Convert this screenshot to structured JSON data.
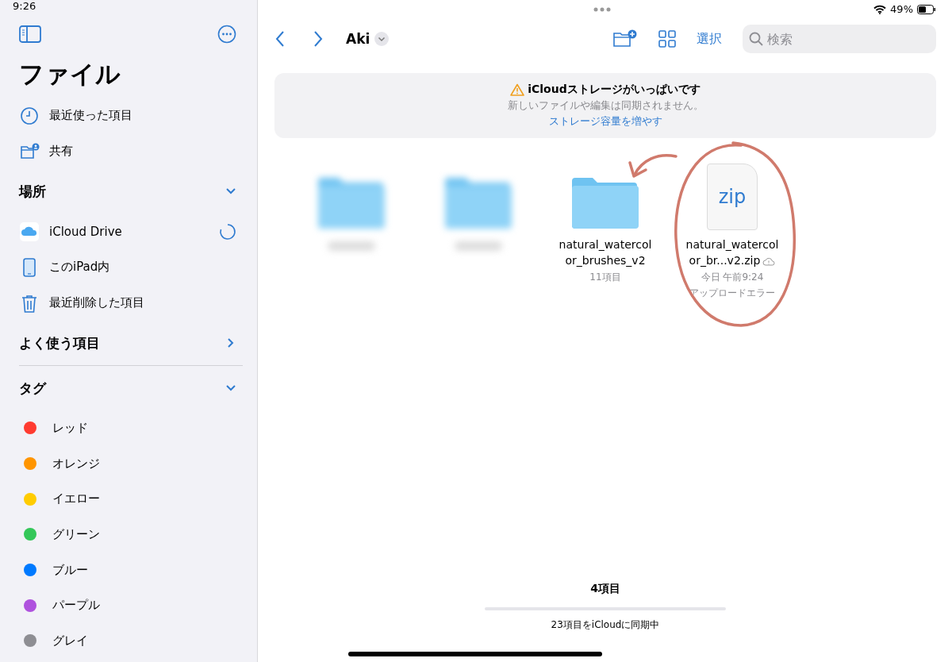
{
  "status_bar": {
    "time": "9:26",
    "battery_percent": "49%"
  },
  "sidebar": {
    "title": "ファイル",
    "top_items": [
      {
        "kind": "clock",
        "label": "最近使った項目"
      },
      {
        "kind": "shared",
        "label": "共有"
      }
    ],
    "sections": [
      {
        "title": "場所",
        "expanded": true,
        "items": [
          {
            "kind": "icloud",
            "label": "iCloud Drive",
            "syncing": true
          },
          {
            "kind": "ipad",
            "label": "このiPad内",
            "syncing": false
          },
          {
            "kind": "trash",
            "label": "最近削除した項目",
            "syncing": false
          }
        ]
      },
      {
        "title": "よく使う項目",
        "expanded": false
      },
      {
        "title": "タグ",
        "expanded": true,
        "tags": [
          {
            "label": "レッド",
            "color": "#ff3b30"
          },
          {
            "label": "オレンジ",
            "color": "#ff9500"
          },
          {
            "label": "イエロー",
            "color": "#ffcc00"
          },
          {
            "label": "グリーン",
            "color": "#34c759"
          },
          {
            "label": "ブルー",
            "color": "#007aff"
          },
          {
            "label": "パープル",
            "color": "#af52de"
          },
          {
            "label": "グレイ",
            "color": "#8e8e93"
          }
        ]
      }
    ]
  },
  "toolbar": {
    "folder": "Aki",
    "select": "選択",
    "search": {
      "placeholder": "検索"
    }
  },
  "banner": {
    "title": "iCloudストレージがいっぱいです",
    "message": "新しいファイルや編集は同期されません。",
    "link": "ストレージ容量を増やす"
  },
  "files": [
    {
      "kind": "blurred-folder"
    },
    {
      "kind": "blurred-folder"
    },
    {
      "kind": "folder",
      "name": "natural_watercolor_brushes_v2",
      "details": [
        "11項目"
      ]
    },
    {
      "kind": "zip",
      "name": "natural_watercolor_br...v2.zip",
      "icon_text": "zip",
      "cloud_error": true,
      "details": [
        "今日 午前9:24",
        "アップロードエラー"
      ]
    }
  ],
  "footer": {
    "count": "4項目",
    "sync": {
      "level": 0,
      "text": "23項目をiCloudに同期中"
    }
  }
}
